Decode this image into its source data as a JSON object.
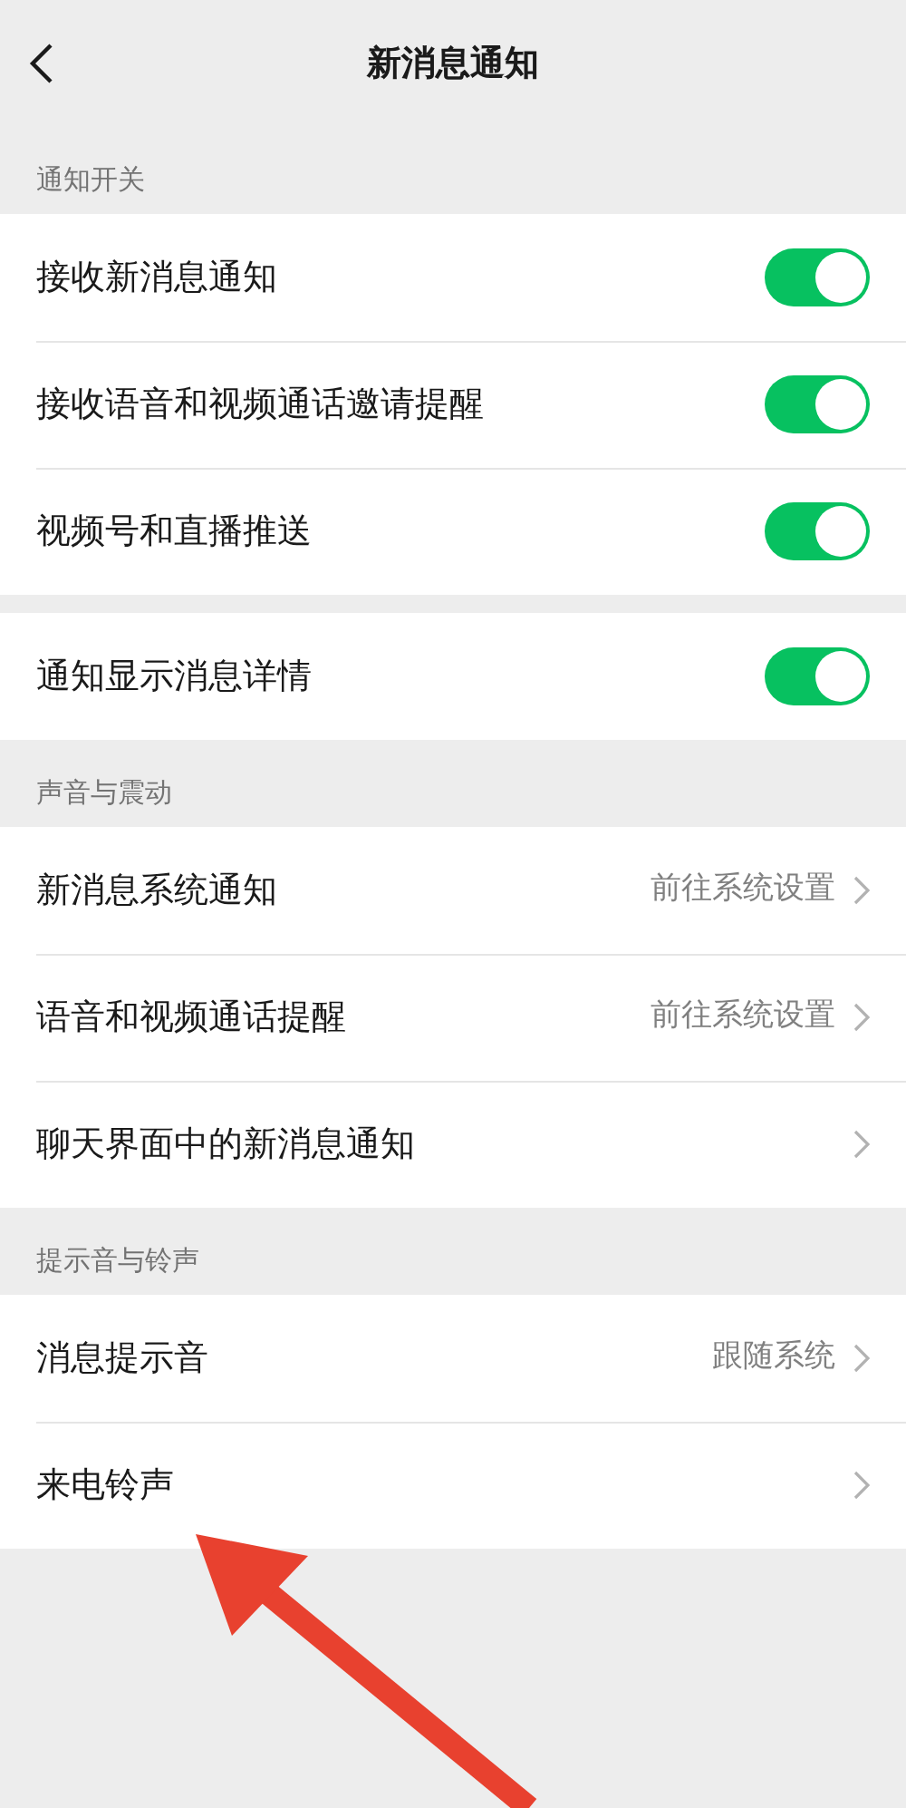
{
  "header": {
    "title": "新消息通知"
  },
  "sections": [
    {
      "label": "通知开关",
      "rows": [
        {
          "kind": "toggle",
          "label": "接收新消息通知",
          "on": true
        },
        {
          "kind": "toggle",
          "label": "接收语音和视频通话邀请提醒",
          "on": true
        },
        {
          "kind": "toggle",
          "label": "视频号和直播推送",
          "on": true
        }
      ]
    },
    {
      "rows": [
        {
          "kind": "toggle",
          "label": "通知显示消息详情",
          "on": true
        }
      ]
    },
    {
      "label": "声音与震动",
      "rows": [
        {
          "kind": "link",
          "label": "新消息系统通知",
          "value": "前往系统设置"
        },
        {
          "kind": "link",
          "label": "语音和视频通话提醒",
          "value": "前往系统设置"
        },
        {
          "kind": "link",
          "label": "聊天界面中的新消息通知"
        }
      ]
    },
    {
      "label": "提示音与铃声",
      "rows": [
        {
          "kind": "link",
          "label": "消息提示音",
          "value": "跟随系统"
        },
        {
          "kind": "link",
          "label": "来电铃声"
        }
      ]
    }
  ]
}
